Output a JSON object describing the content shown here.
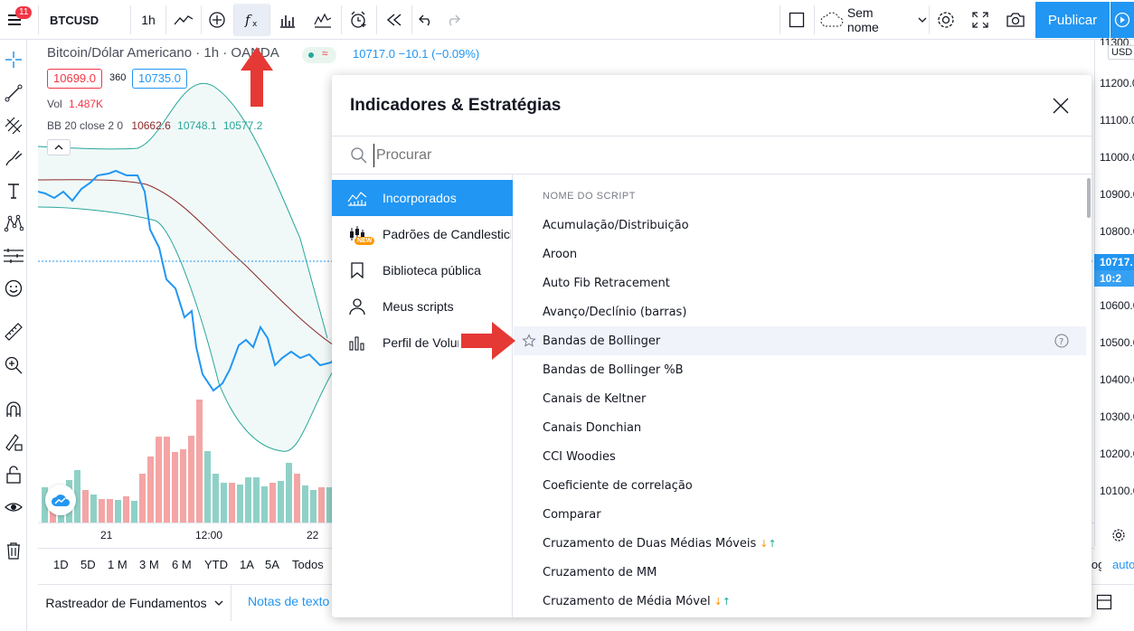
{
  "topbar": {
    "menu_badge": "11",
    "symbol": "BTCUSD",
    "interval": "1h",
    "layout_name": "Sem nome",
    "publish_label": "Publicar",
    "icons": [
      "menu-icon",
      "line-chart-icon",
      "add-compare-icon",
      "indicators-fx-icon",
      "bar-chart-type-icon",
      "templates-icon",
      "alert-icon",
      "replay-icon",
      "undo-icon",
      "redo-icon",
      "layout-square-icon",
      "cloud-icon",
      "chevron-down-icon",
      "settings-icon",
      "fullscreen-icon",
      "camera-icon"
    ]
  },
  "legend": {
    "title": "Bitcoin/Dólar Americano · 1h · OANDA",
    "price_info": "10717.0 −10.1 (−0.09%)",
    "bid": "10699.0",
    "spread": "360",
    "ask": "10735.0",
    "vol_label": "Vol",
    "vol_value": "1.487K",
    "bb_label": "BB 20 close 2 0",
    "bb_mid": "10662.6",
    "bb_upper": "10748.1",
    "bb_lower": "10577.2"
  },
  "price_scale": {
    "top_partial": "11300.",
    "currency": "USD",
    "labels": [
      "11200.0",
      "11100.0",
      "11000.0",
      "10900.0",
      "10800.0",
      "10700.0",
      "10600.0",
      "10500.0",
      "10400.0",
      "10300.0",
      "10200.0",
      "10100.0"
    ],
    "current_price": "10717.",
    "countdown": "10:2",
    "colors": {
      "current": "#2196f3"
    }
  },
  "time_axis": {
    "labels": [
      "21",
      "12:00",
      "22"
    ]
  },
  "range_bar": {
    "items": [
      "1D",
      "5D",
      "1 M",
      "3 M",
      "6 M",
      "YTD",
      "1A",
      "5A",
      "Todos"
    ],
    "right_partial": "log",
    "right_auto": "auto"
  },
  "bottom_tabs": {
    "screener": "Rastreador de Fundamentos",
    "notes": "Notas de texto"
  },
  "modal": {
    "title": "Indicadores & Estratégias",
    "search_placeholder": "Procurar",
    "sidebar": [
      {
        "label": "Incorporados",
        "active": true,
        "icon": "builtin-chart-icon"
      },
      {
        "label": "Padrões de Candlesticks",
        "active": false,
        "icon": "candlestick-icon",
        "badge": "NEW"
      },
      {
        "label": "Biblioteca pública",
        "active": false,
        "icon": "bookmark-icon"
      },
      {
        "label": "Meus scripts",
        "active": false,
        "icon": "user-icon"
      },
      {
        "label": "Perfil de Volume",
        "active": false,
        "icon": "volume-profile-icon"
      }
    ],
    "list_header": "NOME DO SCRIPT",
    "items": [
      "Acumulação/Distribuição",
      "Aroon",
      "Auto Fib Retracement",
      "Avanço/Declínio (barras)",
      "Bandas de Bollinger",
      "Bandas de Bollinger %B",
      "Canais de Keltner",
      "Canais Donchian",
      "CCI Woodies",
      "Coeficiente de correlação",
      "Comparar",
      "Cruzamento de Duas Médias Móveis",
      "Cruzamento de MM",
      "Cruzamento de Média Móvel"
    ],
    "highlighted_item": "Bandas de Bollinger",
    "colors": {
      "accent": "#2196f3",
      "arrow_red": "#e53935",
      "arrow_up": "#26a69a",
      "arrow_down": "#ff9800"
    }
  }
}
